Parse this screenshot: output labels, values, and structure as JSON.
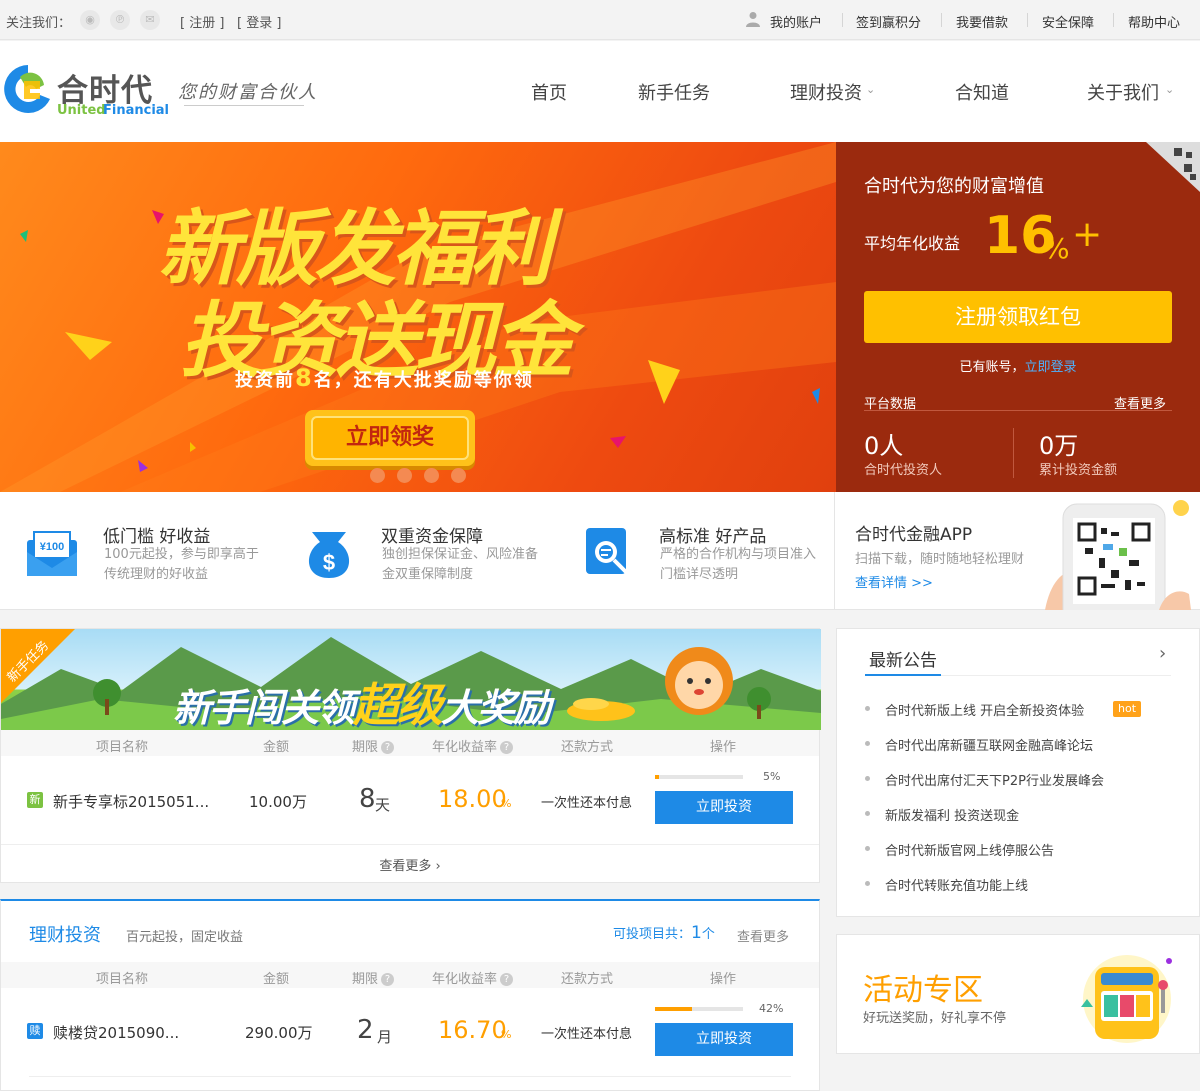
{
  "topbar": {
    "follow_label": "关注我们：",
    "register": "[ 注册 ]",
    "login": "[ 登录 ]",
    "links": [
      "我的账户",
      "签到赢积分",
      "我要借款",
      "安全保障",
      "帮助中心"
    ]
  },
  "header": {
    "logo_cn": "合时代",
    "logo_en_1": "United",
    "logo_en_2": "Financial",
    "slogan": "您的财富合伙人",
    "nav": [
      "首页",
      "新手任务",
      "理财投资",
      "合知道",
      "关于我们"
    ]
  },
  "banner": {
    "line1": "新版发福利",
    "line2": "投资送现金",
    "sub_pre": "投资前",
    "sub_num": "8",
    "sub_post": "名，还有大批奖励等你领",
    "button": "立即领奖",
    "slides": 4
  },
  "side": {
    "title": "合时代为您的财富增值",
    "rate_label": "平均年化收益",
    "rate_value": "16",
    "rate_unit": "%",
    "rate_plus": "+",
    "register_button": "注册领取红包",
    "have_account": "已有账号，",
    "login_link": "立即登录",
    "platform_data": "平台数据",
    "more": "查看更多",
    "investors_value": "0人",
    "investors_label": "合时代投资人",
    "amount_value": "0万",
    "amount_label": "累计投资金额"
  },
  "features": [
    {
      "title": "低门槛 好收益",
      "desc": "100元起投，参与即享高于传统理财的好收益",
      "icon": "envelope-icon"
    },
    {
      "title": "双重资金保障",
      "desc": "独创担保保证金、风险准备金双重保障制度",
      "icon": "money-bag-icon"
    },
    {
      "title": "高标准 好产品",
      "desc": "严格的合作机构与项目准入门槛详尽透明",
      "icon": "magnifier-doc-icon"
    }
  ],
  "app": {
    "title": "合时代金融APP",
    "desc": "扫描下载，随时随地轻松理财",
    "link": "查看详情 >>"
  },
  "novice": {
    "ribbon": "新手任务",
    "banner_text_1": "新手闯关",
    "banner_text_2": "领",
    "banner_text_3": "超级",
    "banner_text_4": "大奖励",
    "headers": [
      "项目名称",
      "金额",
      "期限",
      "年化收益率",
      "还款方式",
      "操作"
    ],
    "row": {
      "tag": "新",
      "name": "新手专享标2015051...",
      "amount": "10.00万",
      "term_num": "8",
      "term_unit": "天",
      "rate": "18.00",
      "rate_unit": "%",
      "repay": "一次性还本付息",
      "progress_pct": 5,
      "progress_label": "5%",
      "button": "立即投资"
    },
    "more": "查看更多"
  },
  "finance": {
    "title": "理财投资",
    "subtitle": "百元起投，固定收益",
    "count_label": "可投项目共：",
    "count_value": "1",
    "count_unit": "个",
    "more": "查看更多",
    "headers": [
      "项目名称",
      "金额",
      "期限",
      "年化收益率",
      "还款方式",
      "操作"
    ],
    "row": {
      "tag": "赎",
      "name": "赎楼贷2015090...",
      "amount": "290.00万",
      "term_num": "2",
      "term_unit": "月",
      "rate": "16.70",
      "rate_unit": "%",
      "repay": "一次性还本付息",
      "progress_pct": 42,
      "progress_label": "42%",
      "button": "立即投资"
    }
  },
  "notices": {
    "title": "最新公告",
    "hot": "hot",
    "items": [
      "合时代新版上线 开启全新投资体验",
      "合时代出席新疆互联网金融高峰论坛",
      "合时代出席付汇天下P2P行业发展峰会",
      "新版发福利 投资送现金",
      "合时代新版官网上线停服公告",
      "合时代转账充值功能上线"
    ]
  },
  "activity": {
    "title": "活动专区",
    "desc": "好玩送奖励，好礼享不停"
  },
  "colors": {
    "accent_blue": "#1e8ae6",
    "rate_orange": "#ff9f00",
    "yellow": "#ffc000",
    "side_red": "#9b2a0e"
  }
}
